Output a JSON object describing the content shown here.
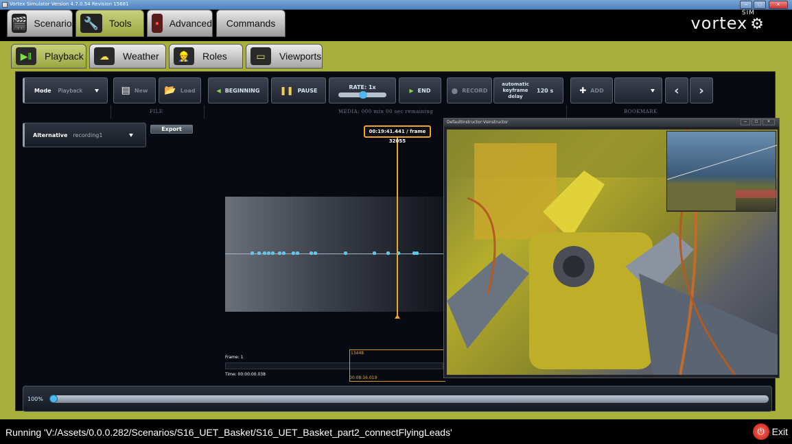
{
  "window": {
    "title": "Vortex Simulator Version 4.7.0.54 Revision 15681"
  },
  "logo": {
    "text": "vortex",
    "sim": "SIM"
  },
  "main_tabs": [
    {
      "label": "Scenarios",
      "icon": "clapper-icon"
    },
    {
      "label": "Tools",
      "icon": "wrench-icon"
    },
    {
      "label": "Advanced",
      "icon": "record-icon"
    },
    {
      "label": "Commands",
      "icon": ""
    }
  ],
  "sub_tabs": [
    {
      "label": "Playback",
      "icon": "playback-icon"
    },
    {
      "label": "Weather",
      "icon": "cloud-sun-icon"
    },
    {
      "label": "Roles",
      "icon": "worker-icon"
    },
    {
      "label": "Viewports",
      "icon": "monitor-icon"
    }
  ],
  "toolbar": {
    "mode_label": "Mode",
    "mode_value": "Playback",
    "new_label": "New",
    "load_label": "Load",
    "file_group": "FILE",
    "beginning_label": "BEGINNING",
    "pause_label": "PAUSE",
    "rate_label": "RATE: 1x",
    "end_label": "END",
    "record_label": "RECORD",
    "keyframe_label": "automatic keyframe delay",
    "keyframe_value": "120 s",
    "media_group": "MEDIA: 000 min 00 sec remaining",
    "add_label": "ADD",
    "bookmark_group": "BOOKMARK"
  },
  "alternative": {
    "label": "Alternative",
    "value": "recording1",
    "export_label": "Export"
  },
  "timeline": {
    "cursor_label": "00:19:41.441 / frame 32055",
    "frame_label": "Frame: 1",
    "time_label": "Time: 00:00:00.038",
    "marker_frame": "13448",
    "marker_time": "00:08:16.019"
  },
  "progress": {
    "label": "100%",
    "value": 1.0
  },
  "viewport": {
    "title": "DefaultInstructor:VsInstructor"
  },
  "status": {
    "text": "Running 'V:/Assets/0.0.0.282/Scenarios/S16_UET_Basket/S16_UET_Basket_part2_connectFlyingLeads'",
    "exit_label": "Exit"
  },
  "colors": {
    "olive": "#a8b03c",
    "accent_orange": "#f1a62a",
    "tick_blue": "#5ec7f0"
  }
}
